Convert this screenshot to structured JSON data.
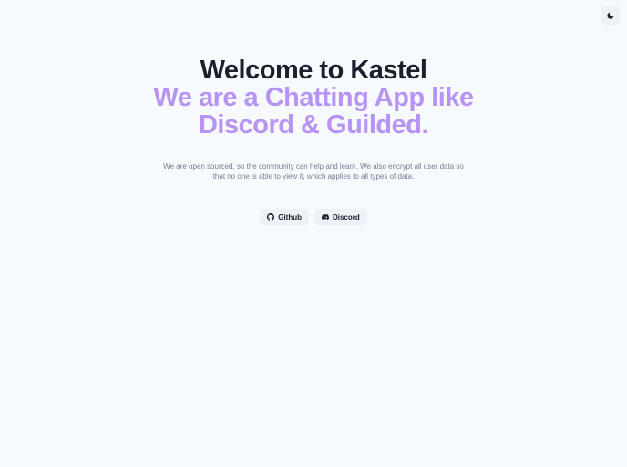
{
  "header": {
    "theme_toggle_icon": "moon-icon"
  },
  "hero": {
    "title": "Welcome to Kastel",
    "subtitle": "We are a Chatting App like Discord & Guilded.",
    "description": "We are open sourced, so the community can help and learn. We also encrypt all user data so that no one is able to view it, which applies to all types of data."
  },
  "buttons": {
    "github_label": "Github",
    "github_icon": "github-icon",
    "discord_label": "Discord",
    "discord_icon": "discord-icon"
  },
  "colors": {
    "background": "#f7fafc",
    "title": "#1a202c",
    "accent": "#b794f4",
    "muted_text": "#718096",
    "button_bg": "#edf2f7"
  }
}
